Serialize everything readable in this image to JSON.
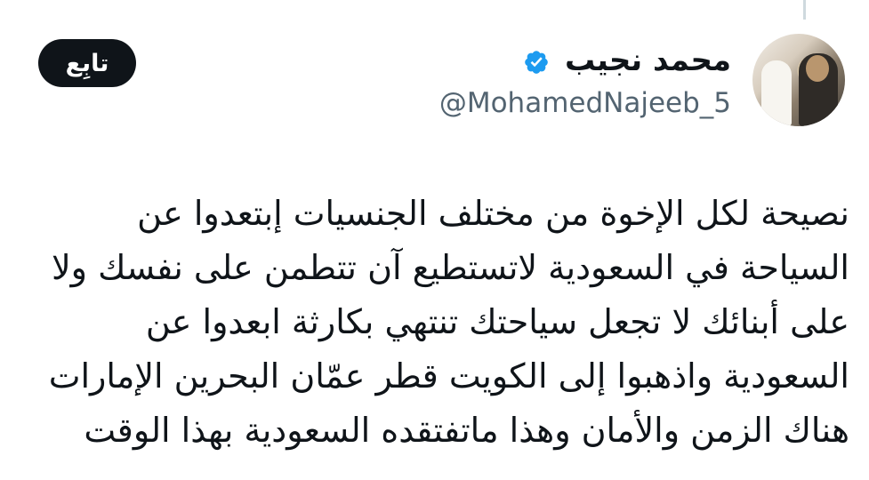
{
  "tweet": {
    "author": {
      "display_name": "محمد نجيب",
      "handle": "@MohamedNajeeb_5",
      "verified": true,
      "verified_color": "#1d9bf0"
    },
    "follow_button_label": "تابِع",
    "text_lines": [
      "نصيحة لكل الإخوة من مختلف الجنسيات إبتعدوا عن",
      "السياحة في السعودية لاتستطيع آن تتطمن على نفسك ولا",
      "على أبنائك لا تجعل سياحتك تنتهي بكارثة ابعدوا عن",
      "السعودية واذهبوا إلى الكويت قطر عمّان البحرين الإمارات",
      "هناك الزمن والأمان وهذا ماتفتقده السعودية بهذا الوقت"
    ]
  },
  "colors": {
    "text": "#0f1419",
    "secondary_text": "#536471",
    "follow_button_bg": "#0f1419",
    "thread_line": "#cfd9de"
  }
}
